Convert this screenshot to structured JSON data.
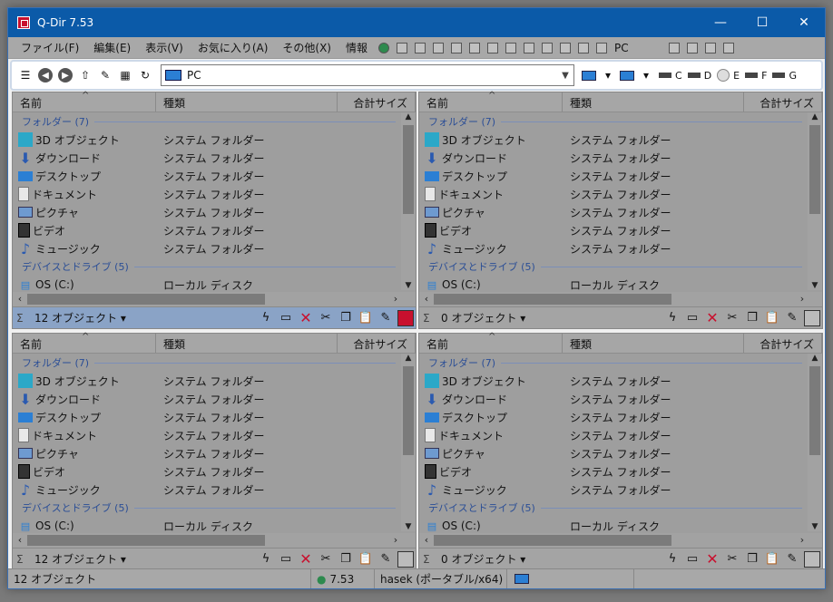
{
  "window": {
    "title": "Q-Dir 7.53",
    "buttons": {
      "minimize": "—",
      "maximize": "☐",
      "close": "✕"
    }
  },
  "menu": [
    "ファイル(F)",
    "編集(E)",
    "表示(V)",
    "お気に入り(A)",
    "その他(X)",
    "情報"
  ],
  "menu_pc_label": "PC",
  "toolbar": {
    "address": "PC",
    "drives": [
      "C",
      "D",
      "E",
      "F",
      "G"
    ]
  },
  "pane_headers": {
    "name": "名前",
    "type": "種類",
    "size": "合計サイズ"
  },
  "groups": {
    "folders": "フォルダー (7)",
    "devices": "デバイスとドライブ (5)"
  },
  "folders": [
    {
      "name": "3D オブジェクト",
      "type": "システム フォルダー",
      "icon": "cube-icon"
    },
    {
      "name": "ダウンロード",
      "type": "システム フォルダー",
      "icon": "download-arrow-icon"
    },
    {
      "name": "デスクトップ",
      "type": "システム フォルダー",
      "icon": "desktop-icon"
    },
    {
      "name": "ドキュメント",
      "type": "システム フォルダー",
      "icon": "document-icon"
    },
    {
      "name": "ピクチャ",
      "type": "システム フォルダー",
      "icon": "pictures-icon"
    },
    {
      "name": "ビデオ",
      "type": "システム フォルダー",
      "icon": "video-icon"
    },
    {
      "name": "ミュージック",
      "type": "システム フォルダー",
      "icon": "music-note-icon"
    }
  ],
  "drive_row": {
    "name": "OS (C:)",
    "type": "ローカル ディスク"
  },
  "panes": [
    {
      "count": "12 オブジェクト",
      "active": true
    },
    {
      "count": "0 オブジェクト",
      "active": false
    },
    {
      "count": "12 オブジェクト",
      "active": false
    },
    {
      "count": "0 オブジェクト",
      "active": false
    }
  ],
  "statusbar": {
    "objects": "12 オブジェクト",
    "version": "7.53",
    "user": "hasek (ポータブル/x64)"
  },
  "colors": {
    "titlebar": "#0b5aa8",
    "active_pane_status": "#8aa3c6",
    "accent_red": "#c8102e"
  }
}
